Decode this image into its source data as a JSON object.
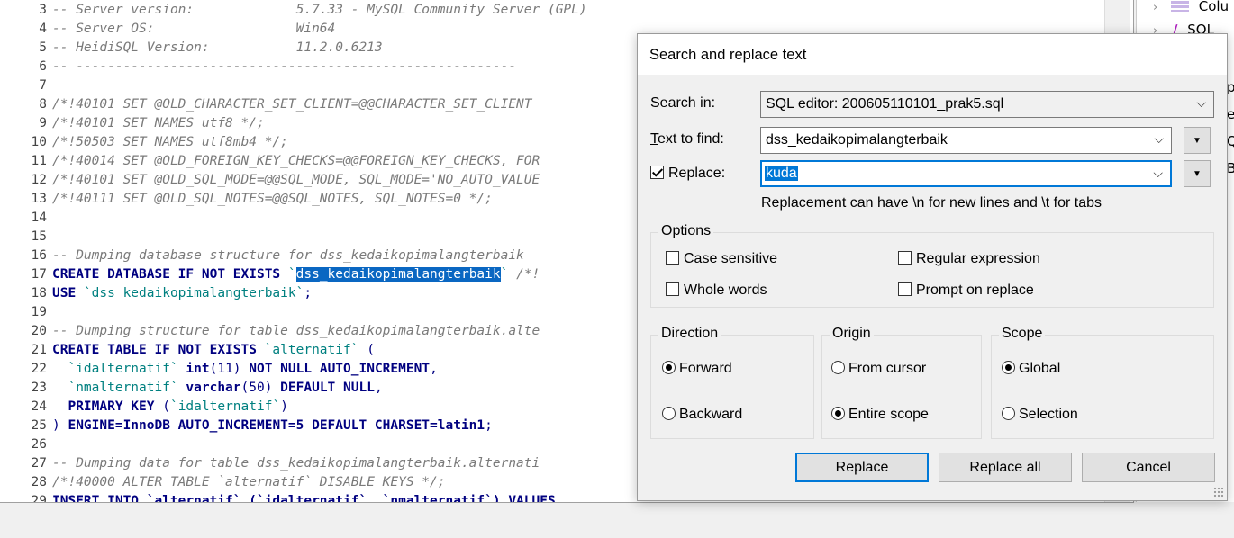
{
  "editor": {
    "lines": [
      {
        "n": "3",
        "segs": [
          {
            "t": "-- Server version:             5.7.33 - MySQL Community Server (GPL)",
            "c": "cm"
          }
        ]
      },
      {
        "n": "4",
        "segs": [
          {
            "t": "-- Server OS:                  Win64",
            "c": "cm"
          }
        ]
      },
      {
        "n": "5",
        "segs": [
          {
            "t": "-- HeidiSQL Version:           11.2.0.6213",
            "c": "cm"
          }
        ]
      },
      {
        "n": "6",
        "segs": [
          {
            "t": "-- --------------------------------------------------------",
            "c": "cm"
          }
        ]
      },
      {
        "n": "7",
        "segs": []
      },
      {
        "n": "8",
        "segs": [
          {
            "t": "/*!40101 SET @OLD_CHARACTER_SET_CLIENT=@@CHARACTER_SET_CLIENT",
            "c": "cm"
          }
        ]
      },
      {
        "n": "9",
        "segs": [
          {
            "t": "/*!40101 SET NAMES utf8 */;",
            "c": "cm"
          }
        ]
      },
      {
        "n": "10",
        "segs": [
          {
            "t": "/*!50503 SET NAMES utf8mb4 */;",
            "c": "cm"
          }
        ]
      },
      {
        "n": "11",
        "segs": [
          {
            "t": "/*!40014 SET @OLD_FOREIGN_KEY_CHECKS=@@FOREIGN_KEY_CHECKS, FOR",
            "c": "cm"
          }
        ]
      },
      {
        "n": "12",
        "segs": [
          {
            "t": "/*!40101 SET @OLD_SQL_MODE=@@SQL_MODE, SQL_MODE='NO_AUTO_VALUE",
            "c": "cm"
          }
        ]
      },
      {
        "n": "13",
        "segs": [
          {
            "t": "/*!40111 SET @OLD_SQL_NOTES=@@SQL_NOTES, SQL_NOTES=0 */;",
            "c": "cm"
          }
        ]
      },
      {
        "n": "14",
        "segs": []
      },
      {
        "n": "15",
        "segs": []
      },
      {
        "n": "16",
        "segs": [
          {
            "t": "-- Dumping database structure for dss_kedaikopimalangterbaik",
            "c": "cm"
          }
        ]
      },
      {
        "n": "17",
        "segs": [
          {
            "t": "CREATE DATABASE IF NOT EXISTS ",
            "c": "kw"
          },
          {
            "t": "`",
            "c": "bt"
          },
          {
            "t": "dss_kedaikopimalangterbaik",
            "c": "sel"
          },
          {
            "t": "` ",
            "c": "bt"
          },
          {
            "t": "/*!",
            "c": "cm"
          }
        ]
      },
      {
        "n": "18",
        "segs": [
          {
            "t": "USE ",
            "c": "kw"
          },
          {
            "t": "`dss_kedaikopimalangterbaik`",
            "c": "bt"
          },
          {
            "t": ";",
            "c": "code"
          }
        ]
      },
      {
        "n": "19",
        "segs": []
      },
      {
        "n": "20",
        "segs": [
          {
            "t": "-- Dumping structure for table dss_kedaikopimalangterbaik.alte",
            "c": "cm"
          }
        ]
      },
      {
        "n": "21",
        "segs": [
          {
            "t": "CREATE TABLE IF NOT EXISTS ",
            "c": "kw"
          },
          {
            "t": "`alternatif`",
            "c": "bt"
          },
          {
            "t": " (",
            "c": "code"
          }
        ]
      },
      {
        "n": "22",
        "segs": [
          {
            "t": "  `idalternatif` ",
            "c": "bt"
          },
          {
            "t": "int",
            "c": "kw"
          },
          {
            "t": "(11) ",
            "c": "code"
          },
          {
            "t": "NOT NULL AUTO_INCREMENT",
            "c": "kw"
          },
          {
            "t": ",",
            "c": "code"
          }
        ]
      },
      {
        "n": "23",
        "segs": [
          {
            "t": "  `nmalternatif` ",
            "c": "bt"
          },
          {
            "t": "varchar",
            "c": "kw"
          },
          {
            "t": "(50) ",
            "c": "code"
          },
          {
            "t": "DEFAULT NULL",
            "c": "kw"
          },
          {
            "t": ",",
            "c": "code"
          }
        ]
      },
      {
        "n": "24",
        "segs": [
          {
            "t": "  ",
            "c": "code"
          },
          {
            "t": "PRIMARY KEY ",
            "c": "kw"
          },
          {
            "t": "(",
            "c": "code"
          },
          {
            "t": "`idalternatif`",
            "c": "bt"
          },
          {
            "t": ")",
            "c": "code"
          }
        ]
      },
      {
        "n": "25",
        "segs": [
          {
            "t": ") ",
            "c": "code"
          },
          {
            "t": "ENGINE=InnoDB AUTO_INCREMENT=5 DEFAULT CHARSET=latin1",
            "c": "kw"
          },
          {
            "t": ";",
            "c": "code"
          }
        ]
      },
      {
        "n": "26",
        "segs": []
      },
      {
        "n": "27",
        "segs": [
          {
            "t": "-- Dumping data for table dss_kedaikopimalangterbaik.alternati",
            "c": "cm"
          }
        ]
      },
      {
        "n": "28",
        "segs": [
          {
            "t": "/*!40000 ALTER TABLE `alternatif` DISABLE KEYS */;",
            "c": "cm"
          }
        ]
      },
      {
        "n": "29",
        "segs": [
          {
            "t": "INSERT INTO `alternatif` (`idalternatif`, `nmalternatif`) VALUES",
            "c": "kw"
          }
        ]
      }
    ]
  },
  "right_panel": {
    "rows": [
      "Colu",
      "SQL"
    ],
    "clipped": [
      "p",
      "er",
      "Q",
      "Bi"
    ]
  },
  "dialog": {
    "title": "Search and replace text",
    "search_in_label": "Search in:",
    "search_in_value": "SQL editor: 200605110101_prak5.sql",
    "text_to_find_label": "Text to find:",
    "text_to_find_value": "dss_kedaikopimalangterbaik",
    "replace_label": "Replace:",
    "replace_checked": true,
    "replace_value": "kuda",
    "hint": "Replacement can have \\n for new lines and \\t for tabs",
    "options_title": "Options",
    "options": {
      "case_sensitive": "Case sensitive",
      "whole_words": "Whole words",
      "regular_expression": "Regular expression",
      "prompt_on_replace": "Prompt on replace"
    },
    "direction_title": "Direction",
    "direction": {
      "forward": "Forward",
      "backward": "Backward"
    },
    "origin_title": "Origin",
    "origin": {
      "from_cursor": "From cursor",
      "entire_scope": "Entire scope"
    },
    "scope_title": "Scope",
    "scope": {
      "global": "Global",
      "selection": "Selection"
    },
    "buttons": {
      "replace": "Replace",
      "replace_all": "Replace all",
      "cancel": "Cancel"
    }
  }
}
